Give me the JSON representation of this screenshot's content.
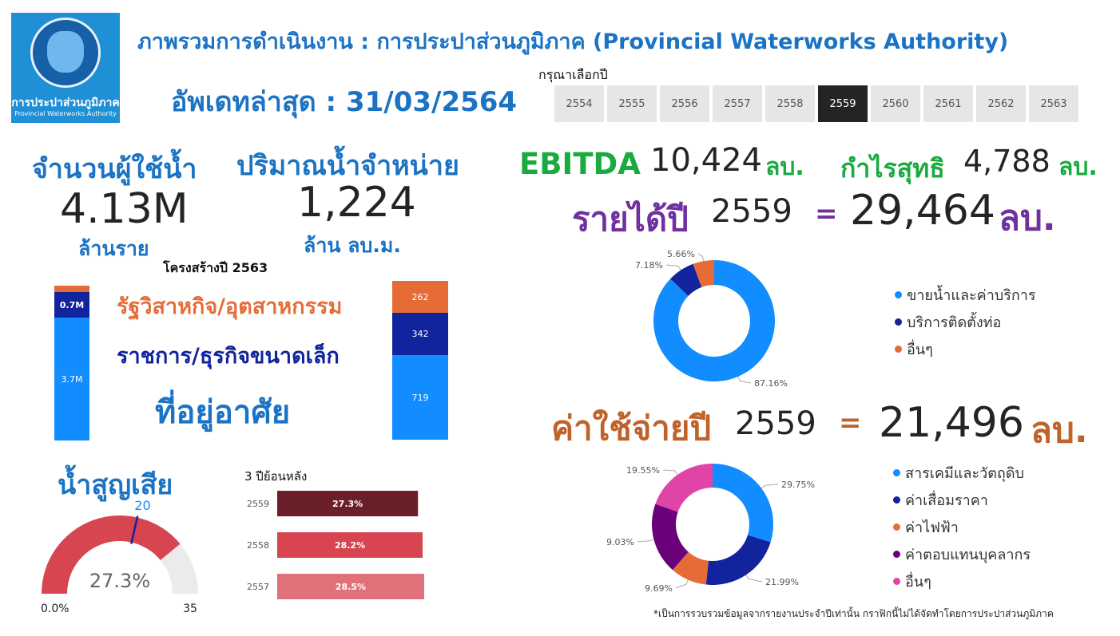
{
  "logo": {
    "line1": "การประปาส่วนภูมิภาค",
    "line2": "Provincial Waterworks Authority"
  },
  "header": {
    "title": "ภาพรวมการดำเนินงาน : การประปาส่วนภูมิภาค (Provincial Waterworks Authority)",
    "updated": "อัพเดทล่าสุด : 31/03/2564"
  },
  "year_slicer": {
    "label": "กรุณาเลือกปี",
    "years": [
      "2554",
      "2555",
      "2556",
      "2557",
      "2558",
      "2559",
      "2560",
      "2561",
      "2562",
      "2563"
    ],
    "selected": "2559"
  },
  "users": {
    "label": "จำนวนผู้ใช้น้ำ",
    "value": "4.13M",
    "unit": "ล้านราย"
  },
  "volume": {
    "label": "ปริมาณน้ำจำหน่าย",
    "value": "1,224",
    "unit": "ล้าน ลบ.ม."
  },
  "structure": {
    "title": "โครงสร้างปี 2563",
    "cat_industry": "รัฐวิสาหกิจ/อุตสาหกรรม",
    "cat_business": "ราชการ/ธุรกิจขนาดเล็ก",
    "cat_residential": "ที่อยู่อาศัย",
    "users_bar": {
      "industry_label": "",
      "business_label": "0.7M",
      "residential_label": "3.7M"
    },
    "volume_bar": {
      "industry_label": "262",
      "business_label": "342",
      "residential_label": "719"
    }
  },
  "water_loss": {
    "title": "น้ำสูญเสีย",
    "value_label": "27.3%",
    "target_label": "20",
    "min_label": "0.0%",
    "max_label": "35",
    "history_title": "3 ปีย้อนหลัง",
    "history": [
      {
        "year": "2559",
        "label": "27.3%"
      },
      {
        "year": "2558",
        "label": "28.2%"
      },
      {
        "year": "2557",
        "label": "28.5%"
      }
    ]
  },
  "finance": {
    "ebitda_label": "EBITDA",
    "ebitda_value": "10,424",
    "ebitda_unit": "ลบ.",
    "profit_label": "กำไรสุทธิ",
    "profit_value": "4,788",
    "profit_unit": "ลบ.",
    "revenue_label": "รายได้ปี",
    "revenue_year": "2559",
    "revenue_eq": "=",
    "revenue_value": "29,464",
    "revenue_unit": "ลบ.",
    "expense_label": "ค่าใช้จ่ายปี",
    "expense_year": "2559",
    "expense_eq": "=",
    "expense_value": "21,496",
    "expense_unit": "ลบ."
  },
  "colors": {
    "blue": "#1a73c5",
    "bright_blue": "#118dff",
    "navy": "#12239e",
    "orange": "#e66c37",
    "purple": "#6b007b",
    "pink": "#e044a7",
    "green": "#1aab40",
    "violet": "#7030a0",
    "brown_orange": "#c0622a",
    "dark_red": "#6b1f29",
    "red": "#d64550",
    "light_red": "#e0717a"
  },
  "chart_data": [
    {
      "type": "bar",
      "title": "",
      "categories": [
        "ที่อยู่อาศัย",
        "ราชการ/ธุรกิจขนาดเล็ก",
        "รัฐวิสาหกิจ/อุตสาหกรรม"
      ],
      "series": [
        {
          "name": "จำนวนผู้ใช้น้ำ",
          "values": [
            3.7,
            0.7,
            0.06
          ]
        }
      ],
      "stacked": true
    },
    {
      "type": "bar",
      "title": "",
      "categories": [
        "ที่อยู่อาศัย",
        "ราชการ/ธุรกิจขนาดเล็ก",
        "รัฐวิสาหกิจ/อุตสาหกรรม"
      ],
      "series": [
        {
          "name": "ปริมาณน้ำจำหน่าย",
          "values": [
            719,
            342,
            262
          ]
        }
      ],
      "stacked": true
    },
    {
      "type": "pie",
      "title": "",
      "categories": [
        "ขายน้ำและค่าบริการ",
        "บริการติดตั้งท่อ",
        "อื่นๆ"
      ],
      "values": [
        87.16,
        7.18,
        5.66
      ],
      "labels": [
        "87.16%",
        "7.18%",
        "5.66%"
      ],
      "legend": "right"
    },
    {
      "type": "pie",
      "title": "",
      "categories": [
        "สารเคมีและวัตถุดิบ",
        "ค่าเสื่อมราคา",
        "ค่าไฟฟ้า",
        "ค่าตอบแทนบุคลากร",
        "อื่นๆ"
      ],
      "values": [
        29.75,
        21.99,
        9.69,
        19.03,
        19.55
      ],
      "labels": [
        "29.75%",
        "21.99%",
        "9.69%",
        "19.03%",
        "19.55%"
      ],
      "legend": "right"
    },
    {
      "type": "gauge",
      "title": "",
      "value": 27.3,
      "target": 20,
      "min": 0,
      "max": 35
    },
    {
      "type": "bar",
      "title": "",
      "categories": [
        "2559",
        "2558",
        "2557"
      ],
      "values": [
        27.3,
        28.2,
        28.5
      ],
      "orientation": "horizontal"
    }
  ],
  "footnote": "*เป็นการรวบรวมข้อมูลจากรายงานประจำปีเท่านั้น กราฟิกนี้ไม่ได้จัดทำโดยการประปาส่วนภูมิภาค"
}
